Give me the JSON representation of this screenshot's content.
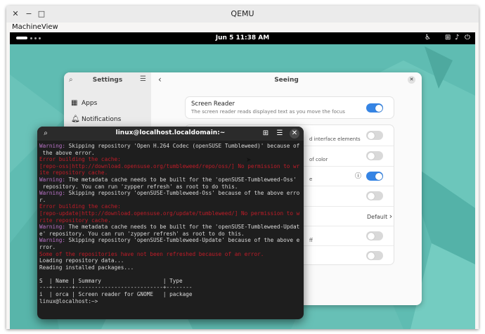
{
  "qemu": {
    "title": "QEMU",
    "menu": [
      "Machine",
      "View"
    ],
    "close_glyph": "✕",
    "minimize_glyph": "−",
    "maximize_glyph": "□"
  },
  "topbar": {
    "date": "Jun 5",
    "time": "11:38 AM",
    "accessibility_icon": "accessibility-icon",
    "network_icon": "network-icon",
    "volume_icon": "volume-icon",
    "power_icon": "power-icon"
  },
  "settings": {
    "sidebar_title": "Settings",
    "sidebar_items": [
      {
        "label": "Apps",
        "icon": "apps-icon"
      },
      {
        "label": "Notifications",
        "icon": "bell-icon"
      }
    ],
    "page_title": "Seeing",
    "screen_reader": {
      "title": "Screen Reader",
      "subtitle": "The screen reader reads displayed text as you move the focus",
      "enabled": true
    },
    "partial_rows": [
      {
        "text": "d interface elements",
        "enabled": false
      },
      {
        "text": "of color",
        "enabled": false
      },
      {
        "text": "e",
        "enabled": true,
        "has_info": true
      },
      {
        "text": "",
        "enabled": false
      },
      {
        "text": "Default",
        "has_chevron": true
      },
      {
        "text": "ff",
        "enabled": false
      },
      {
        "text": "",
        "enabled": false
      }
    ]
  },
  "terminal": {
    "title": "linux@localhost.localdomain:~",
    "lines": [
      {
        "cls": "",
        "parts": [
          {
            "c": "warn",
            "t": "Warning:"
          },
          {
            "c": "",
            "t": " Skipping repository 'Open H.264 Codec (openSUSE Tumbleweed)' because of"
          }
        ]
      },
      {
        "cls": "",
        "parts": [
          {
            "c": "",
            "t": " the above error."
          }
        ]
      },
      {
        "cls": "",
        "parts": [
          {
            "c": "err",
            "t": "Error building the cache:"
          }
        ]
      },
      {
        "cls": "",
        "parts": [
          {
            "c": "err",
            "t": "[repo-oss|http://download.opensuse.org/tumbleweed/repo/oss/] No permission to wr"
          }
        ]
      },
      {
        "cls": "",
        "parts": [
          {
            "c": "err",
            "t": "ite repository cache."
          }
        ]
      },
      {
        "cls": "",
        "parts": [
          {
            "c": "warn",
            "t": "Warning:"
          },
          {
            "c": "",
            "t": " The metadata cache needs to be built for the 'openSUSE-Tumbleweed-Oss'"
          }
        ]
      },
      {
        "cls": "",
        "parts": [
          {
            "c": "",
            "t": " repository. You can run 'zypper refresh' as root to do this."
          }
        ]
      },
      {
        "cls": "",
        "parts": [
          {
            "c": "warn",
            "t": "Warning:"
          },
          {
            "c": "",
            "t": " Skipping repository 'openSUSE-Tumbleweed-Oss' because of the above erro"
          }
        ]
      },
      {
        "cls": "",
        "parts": [
          {
            "c": "",
            "t": "r."
          }
        ]
      },
      {
        "cls": "",
        "parts": [
          {
            "c": "err",
            "t": "Error building the cache:"
          }
        ]
      },
      {
        "cls": "",
        "parts": [
          {
            "c": "err",
            "t": "[repo-update|http://download.opensuse.org/update/tumbleweed/] No permission to w"
          }
        ]
      },
      {
        "cls": "",
        "parts": [
          {
            "c": "err",
            "t": "rite repository cache."
          }
        ]
      },
      {
        "cls": "",
        "parts": [
          {
            "c": "warn",
            "t": "Warning:"
          },
          {
            "c": "",
            "t": " The metadata cache needs to be built for the 'openSUSE-Tumbleweed-Updat"
          }
        ]
      },
      {
        "cls": "",
        "parts": [
          {
            "c": "",
            "t": "e' repository. You can run 'zypper refresh' as root to do this."
          }
        ]
      },
      {
        "cls": "",
        "parts": [
          {
            "c": "warn",
            "t": "Warning:"
          },
          {
            "c": "",
            "t": " Skipping repository 'openSUSE-Tumbleweed-Update' because of the above e"
          }
        ]
      },
      {
        "cls": "",
        "parts": [
          {
            "c": "",
            "t": "rror."
          }
        ]
      },
      {
        "cls": "",
        "parts": [
          {
            "c": "err",
            "t": "Some of the repositories have not been refreshed because of an error."
          }
        ]
      },
      {
        "cls": "",
        "parts": [
          {
            "c": "",
            "t": "Loading repository data..."
          }
        ]
      },
      {
        "cls": "",
        "parts": [
          {
            "c": "",
            "t": "Reading installed packages..."
          }
        ]
      },
      {
        "cls": "",
        "parts": [
          {
            "c": "",
            "t": ""
          }
        ]
      },
      {
        "cls": "",
        "parts": [
          {
            "c": "",
            "t": "S  | Name | Summary                   | Type"
          }
        ]
      },
      {
        "cls": "",
        "parts": [
          {
            "c": "",
            "t": "---+------+---------------------------+--------"
          }
        ]
      },
      {
        "cls": "",
        "parts": [
          {
            "c": "",
            "t": "i  | orca | Screen reader for GNOME   | package"
          }
        ]
      },
      {
        "cls": "",
        "parts": [
          {
            "c": "",
            "t": "linux@localhost:~> "
          }
        ]
      }
    ]
  },
  "colors": {
    "accent": "#3584e4",
    "warning": "#b873c6",
    "error": "#c01c28",
    "desktop": "#5fbcb2"
  }
}
